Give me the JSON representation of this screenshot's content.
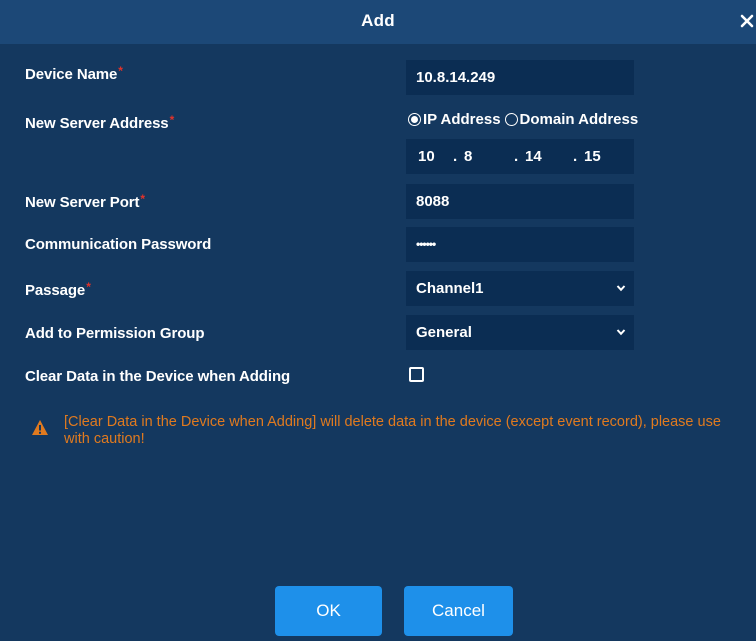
{
  "dialog": {
    "title": "Add",
    "close_icon": "close-icon"
  },
  "form": {
    "device_name": {
      "label": "Device Name",
      "required_mark": "*",
      "value": "10.8.14.249"
    },
    "server_address": {
      "label": "New Server Address",
      "required_mark": "*",
      "options": [
        {
          "label": "IP Address",
          "selected": true
        },
        {
          "label": "Domain Address",
          "selected": false
        }
      ],
      "ip": [
        "10",
        "8",
        "14",
        "15"
      ],
      "separator": "."
    },
    "server_port": {
      "label": "New Server Port",
      "required_mark": "*",
      "value": "8088"
    },
    "comm_password": {
      "label": "Communication Password",
      "value": "••••••"
    },
    "passage": {
      "label": "Passage",
      "required_mark": "*",
      "value": "Channel1"
    },
    "permission_group": {
      "label": "Add to Permission Group",
      "value": "General"
    },
    "clear_data": {
      "label": "Clear Data in the Device when Adding",
      "checked": false
    }
  },
  "warning": {
    "icon": "warning-icon",
    "text": "[Clear Data in the Device when Adding] will delete data in the device (except event record), please use with caution!",
    "color": "#e07a1f"
  },
  "buttons": {
    "ok": "OK",
    "cancel": "Cancel"
  },
  "colors": {
    "background": "#14385f",
    "titlebar": "#1c4877",
    "field": "#0b2d53",
    "button": "#1e90ea",
    "required": "#e2322a"
  }
}
